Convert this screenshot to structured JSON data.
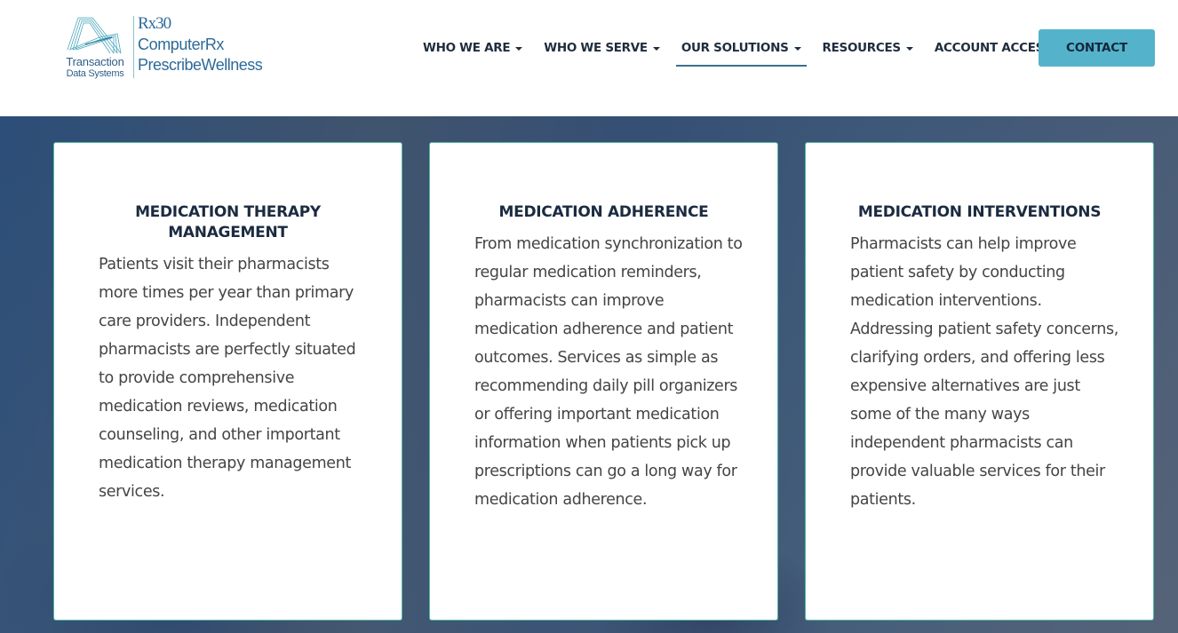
{
  "logo": {
    "company": "Transaction",
    "company_line2": "Data Systems",
    "brand_1": "Rx30",
    "brand_2": "ComputerRx",
    "brand_3": "PrescribeWellness"
  },
  "nav": {
    "items": [
      {
        "label": "WHO WE ARE",
        "has_dropdown": true,
        "active": false
      },
      {
        "label": "WHO WE SERVE",
        "has_dropdown": true,
        "active": false
      },
      {
        "label": "OUR SOLUTIONS",
        "has_dropdown": true,
        "active": true
      },
      {
        "label": "RESOURCES",
        "has_dropdown": true,
        "active": false
      },
      {
        "label": "ACCOUNT ACCESS",
        "has_dropdown": false,
        "active": false
      }
    ],
    "contact_label": "CONTACT"
  },
  "colors": {
    "accent": "#54b3cb",
    "nav_text": "#1f2d3d",
    "active_underline": "#3e6e90",
    "card_border": "#4fb9a5"
  },
  "cards": [
    {
      "title": "MEDICATION THERAPY MANAGEMENT",
      "body": "Patients visit their pharmacists more times per year than primary care providers. Independent pharmacists are perfectly situated to provide comprehensive medication reviews, medication counseling, and other important medication therapy management services."
    },
    {
      "title": "MEDICATION ADHERENCE",
      "body": "From medication synchronization to regular medication reminders, pharmacists can improve medication adherence and patient outcomes. Services as simple as recommending daily pill organizers or offering important medication information when patients pick up prescriptions can go a long way for medication adherence."
    },
    {
      "title": "MEDICATION INTERVENTIONS",
      "body": "Pharmacists can help improve patient safety by conducting medication interventions. Addressing patient safety concerns, clarifying orders, and offering less expensive alternatives are just some of the many ways independent pharmacists can provide valuable services for their patients."
    }
  ]
}
